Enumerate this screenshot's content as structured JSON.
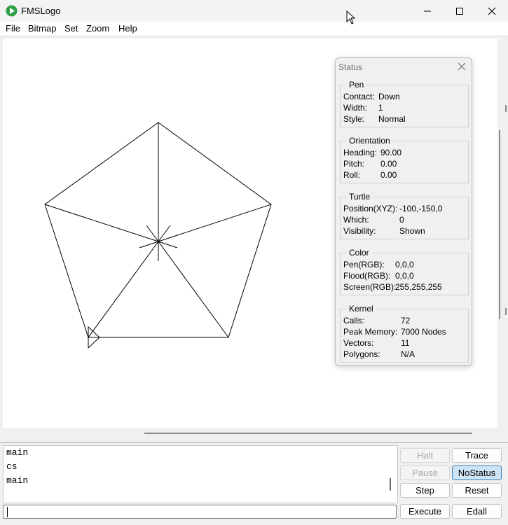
{
  "window": {
    "title": "FMSLogo",
    "accent": "#2ea043"
  },
  "menu": {
    "items": [
      "File",
      "Bitmap",
      "Set",
      "Zoom",
      "Help"
    ]
  },
  "status_panel": {
    "title": "Status",
    "groups": [
      {
        "title": "Pen",
        "rows": [
          {
            "label": "Contact:",
            "value": "Down"
          },
          {
            "label": "Width:",
            "value": "1"
          },
          {
            "label": "Style:",
            "value": "Normal"
          }
        ]
      },
      {
        "title": "Orientation",
        "rows": [
          {
            "label": "Heading:",
            "value": "90.00"
          },
          {
            "label": "Pitch:",
            "value": "0.00"
          },
          {
            "label": "Roll:",
            "value": "0.00"
          }
        ]
      },
      {
        "title": "Turtle",
        "rows": [
          {
            "label": "Position(XYZ):",
            "value": "-100,-150,0"
          },
          {
            "label": "Which:",
            "value": "0"
          },
          {
            "label": "Visibility:",
            "value": "Shown"
          }
        ]
      },
      {
        "title": "Color",
        "rows": [
          {
            "label": "Pen(RGB):",
            "value": "0,0,0"
          },
          {
            "label": "Flood(RGB):",
            "value": "0,0,0"
          },
          {
            "label": "Screen(RGB):",
            "value": "255,255,255"
          }
        ]
      },
      {
        "title": "Kernel",
        "rows": [
          {
            "label": "Calls:",
            "value": "72"
          },
          {
            "label": "Peak Memory:",
            "value": "7000 Nodes"
          },
          {
            "label": "Vectors:",
            "value": "11"
          },
          {
            "label": "Polygons:",
            "value": "N/A"
          }
        ]
      }
    ]
  },
  "commander": {
    "history": [
      "main",
      "cs",
      "main"
    ],
    "input_value": "",
    "buttons": {
      "halt": "Halt",
      "trace": "Trace",
      "pause": "Pause",
      "nostatus": "NoStatus",
      "step": "Step",
      "reset": "Reset",
      "execute": "Execute",
      "edall": "Edall"
    }
  },
  "drawing": {
    "pen_color": "#000000",
    "background": "#ffffff"
  }
}
